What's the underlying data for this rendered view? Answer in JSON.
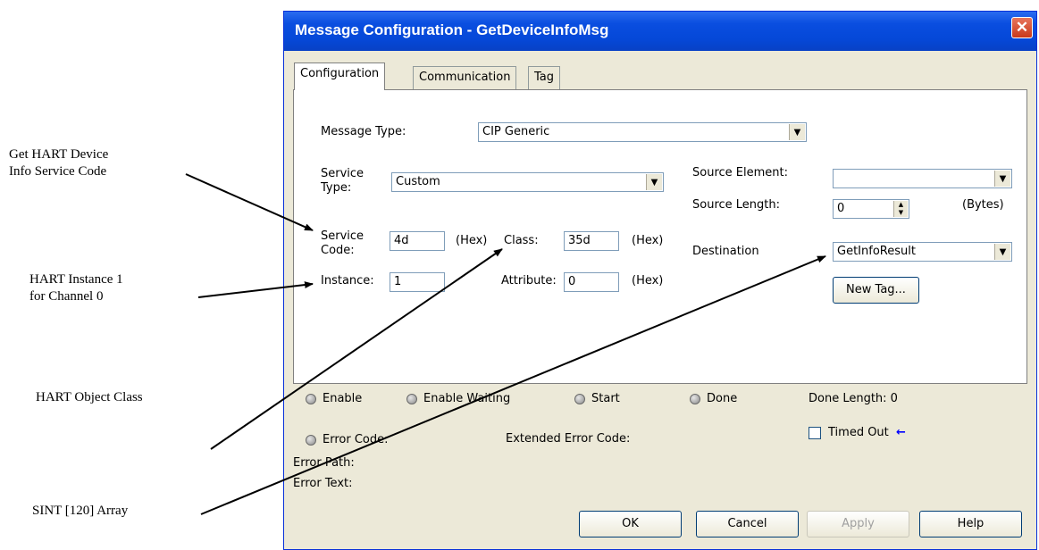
{
  "callouts": {
    "service_code": [
      "Get  HART  Device",
      "Info Service Code"
    ],
    "instance": [
      "HART   Instance   1",
      "for Channel 0"
    ],
    "object_class": "HART Object Class",
    "array": "SINT [120] Array"
  },
  "dialog": {
    "title": "Message Configuration - GetDeviceInfoMsg",
    "close_glyph": "✕",
    "tabs": [
      "Configuration",
      "Communication",
      "Tag"
    ],
    "message_type": {
      "label": "Message Type:",
      "value": "CIP Generic"
    },
    "service_type": {
      "label_line1": "Service",
      "label_line2": "Type:",
      "value": "Custom"
    },
    "service_code": {
      "label_line1": "Service",
      "label_line2": "Code:",
      "value": "4d",
      "unit": "(Hex)"
    },
    "class": {
      "label": "Class:",
      "value": "35d",
      "unit": "(Hex)"
    },
    "instance": {
      "label": "Instance:",
      "value": "1"
    },
    "attribute": {
      "label": "Attribute:",
      "value": "0",
      "unit": "(Hex)"
    },
    "source_element": {
      "label": "Source Element:",
      "value": ""
    },
    "source_length": {
      "label": "Source Length:",
      "value": "0",
      "unit": "(Bytes)"
    },
    "destination": {
      "label": "Destination",
      "value": "GetInfoResult"
    },
    "new_tag_button": "New Tag...",
    "status": {
      "enable": "Enable",
      "enable_waiting": "Enable Waiting",
      "start": "Start",
      "done": "Done",
      "done_length": "Done Length:  0",
      "error_code": "Error Code:",
      "extended_error_code": "Extended Error Code:",
      "timed_out": "Timed Out",
      "timed_out_arrow": "←",
      "error_path": "Error Path:",
      "error_text": "Error Text:"
    },
    "buttons": {
      "ok": "OK",
      "cancel": "Cancel",
      "apply": "Apply",
      "help": "Help"
    }
  },
  "colors": {
    "titlebar": "#0a4ee0",
    "dialog_bg": "#ece9d8",
    "close": "#d2482a"
  }
}
